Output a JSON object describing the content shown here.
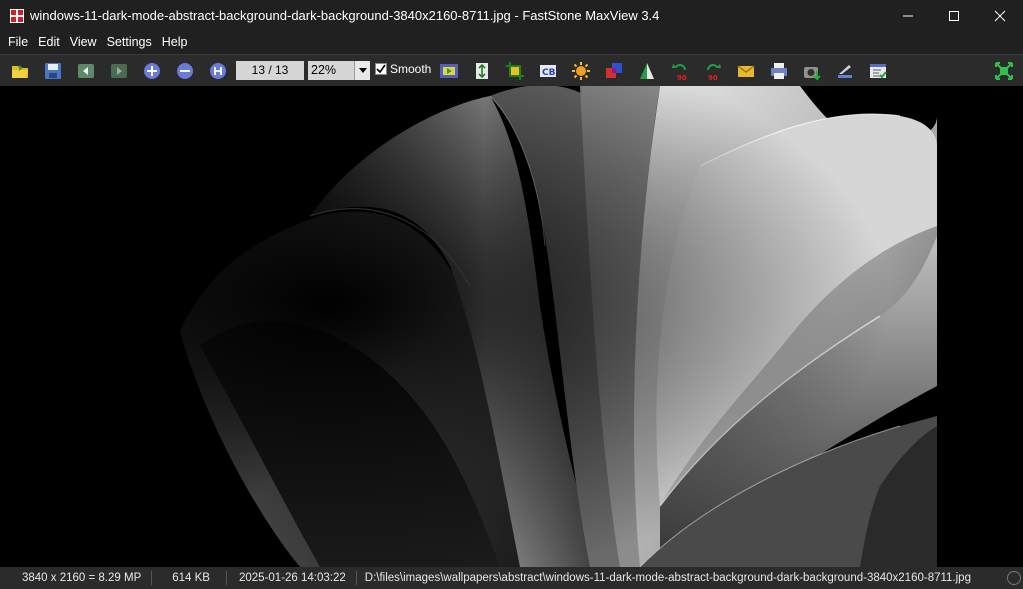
{
  "window": {
    "title": "windows-11-dark-mode-abstract-background-dark-background-3840x2160-8711.jpg - FastStone MaxView 3.4"
  },
  "menu": [
    "File",
    "Edit",
    "View",
    "Settings",
    "Help"
  ],
  "toolbar": {
    "page_counter": "13 / 13",
    "zoom": "22%",
    "smooth_label": "Smooth",
    "smooth_checked": true,
    "buttons": [
      "open-folder-icon",
      "save-icon",
      "previous-icon",
      "next-icon",
      "zoom-in-icon",
      "zoom-out-icon",
      "actual-size-icon",
      "slideshow-icon",
      "resize-icon",
      "crop-icon",
      "text-icon",
      "brightness-icon",
      "colors-icon",
      "sharpen-icon",
      "rotate-left-icon",
      "rotate-right-icon",
      "email-icon",
      "print-icon",
      "capture-icon",
      "scan-icon",
      "settings-icon",
      "fit-window-icon"
    ]
  },
  "status": {
    "dimensions": "3840 x 2160 = 8.29 MP",
    "file_size": "614 KB",
    "date": "2025-01-26 14:03:22",
    "path": "D:\\files\\images\\wallpapers\\abstract\\windows-11-dark-mode-abstract-background-dark-background-3840x2160-8711.jpg"
  }
}
